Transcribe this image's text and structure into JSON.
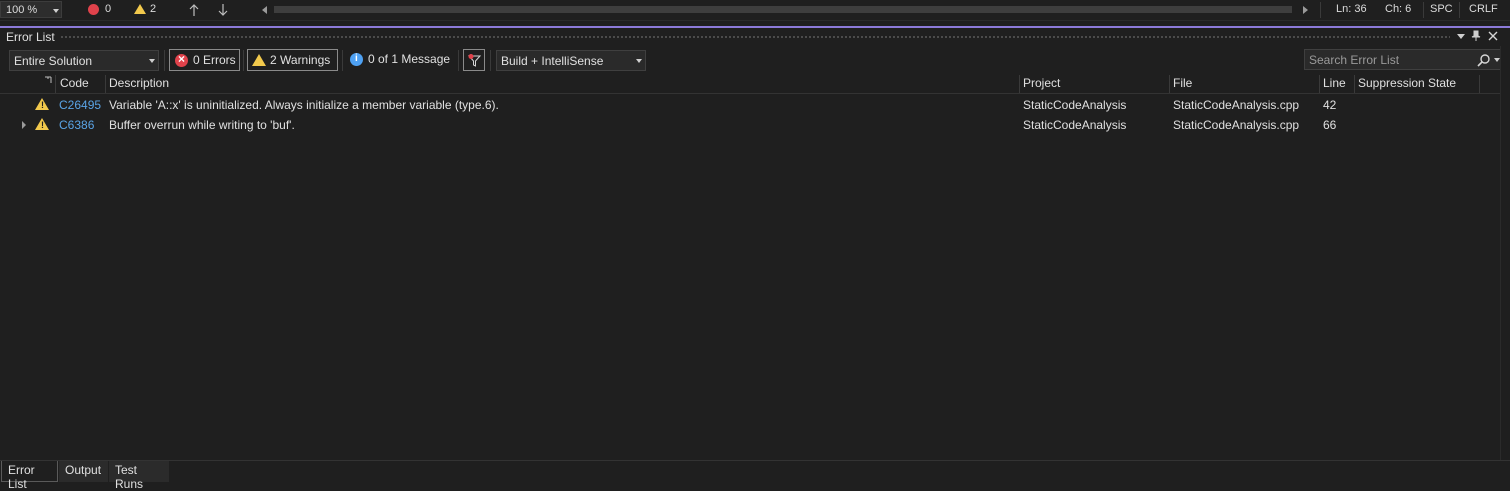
{
  "statusbar": {
    "zoom": "100 %",
    "error_count": "0",
    "warning_count": "2",
    "line": "Ln: 36",
    "column": "Ch: 6",
    "indent": "SPC",
    "line_ending": "CRLF"
  },
  "panel": {
    "title": "Error List"
  },
  "toolbar": {
    "scope": "Entire Solution",
    "errors_label": "0 Errors",
    "warnings_label": "2 Warnings",
    "messages_label": "0 of 1 Message",
    "source": "Build + IntelliSense",
    "search_placeholder": "Search Error List"
  },
  "table": {
    "columns": [
      "Code",
      "Description",
      "Project",
      "File",
      "Line",
      "Suppression State"
    ],
    "rows": [
      {
        "severity": "warning",
        "code": "C26495",
        "description": "Variable 'A::x' is uninitialized. Always initialize a member variable (type.6).",
        "project": "StaticCodeAnalysis",
        "file": "StaticCodeAnalysis.cpp",
        "line": "42",
        "suppression": ""
      },
      {
        "severity": "warning",
        "code": "C6386",
        "description": "Buffer overrun while writing to 'buf'.",
        "project": "StaticCodeAnalysis",
        "file": "StaticCodeAnalysis.cpp",
        "line": "66",
        "suppression": ""
      }
    ]
  },
  "bottom_tabs": [
    "Error List",
    "Output",
    "Test Runs"
  ],
  "colors": {
    "accent": "#8c7ad9",
    "warning": "#f2c94c",
    "error": "#e0424b",
    "info": "#4ea1f3",
    "link": "#5aa4e6"
  },
  "icons": [
    "error-icon",
    "warning-icon",
    "info-icon",
    "filter-icon",
    "search-icon",
    "pin-icon",
    "close-icon",
    "arrow-up-icon",
    "arrow-down-icon",
    "chevron-down-icon",
    "expand-icon"
  ]
}
